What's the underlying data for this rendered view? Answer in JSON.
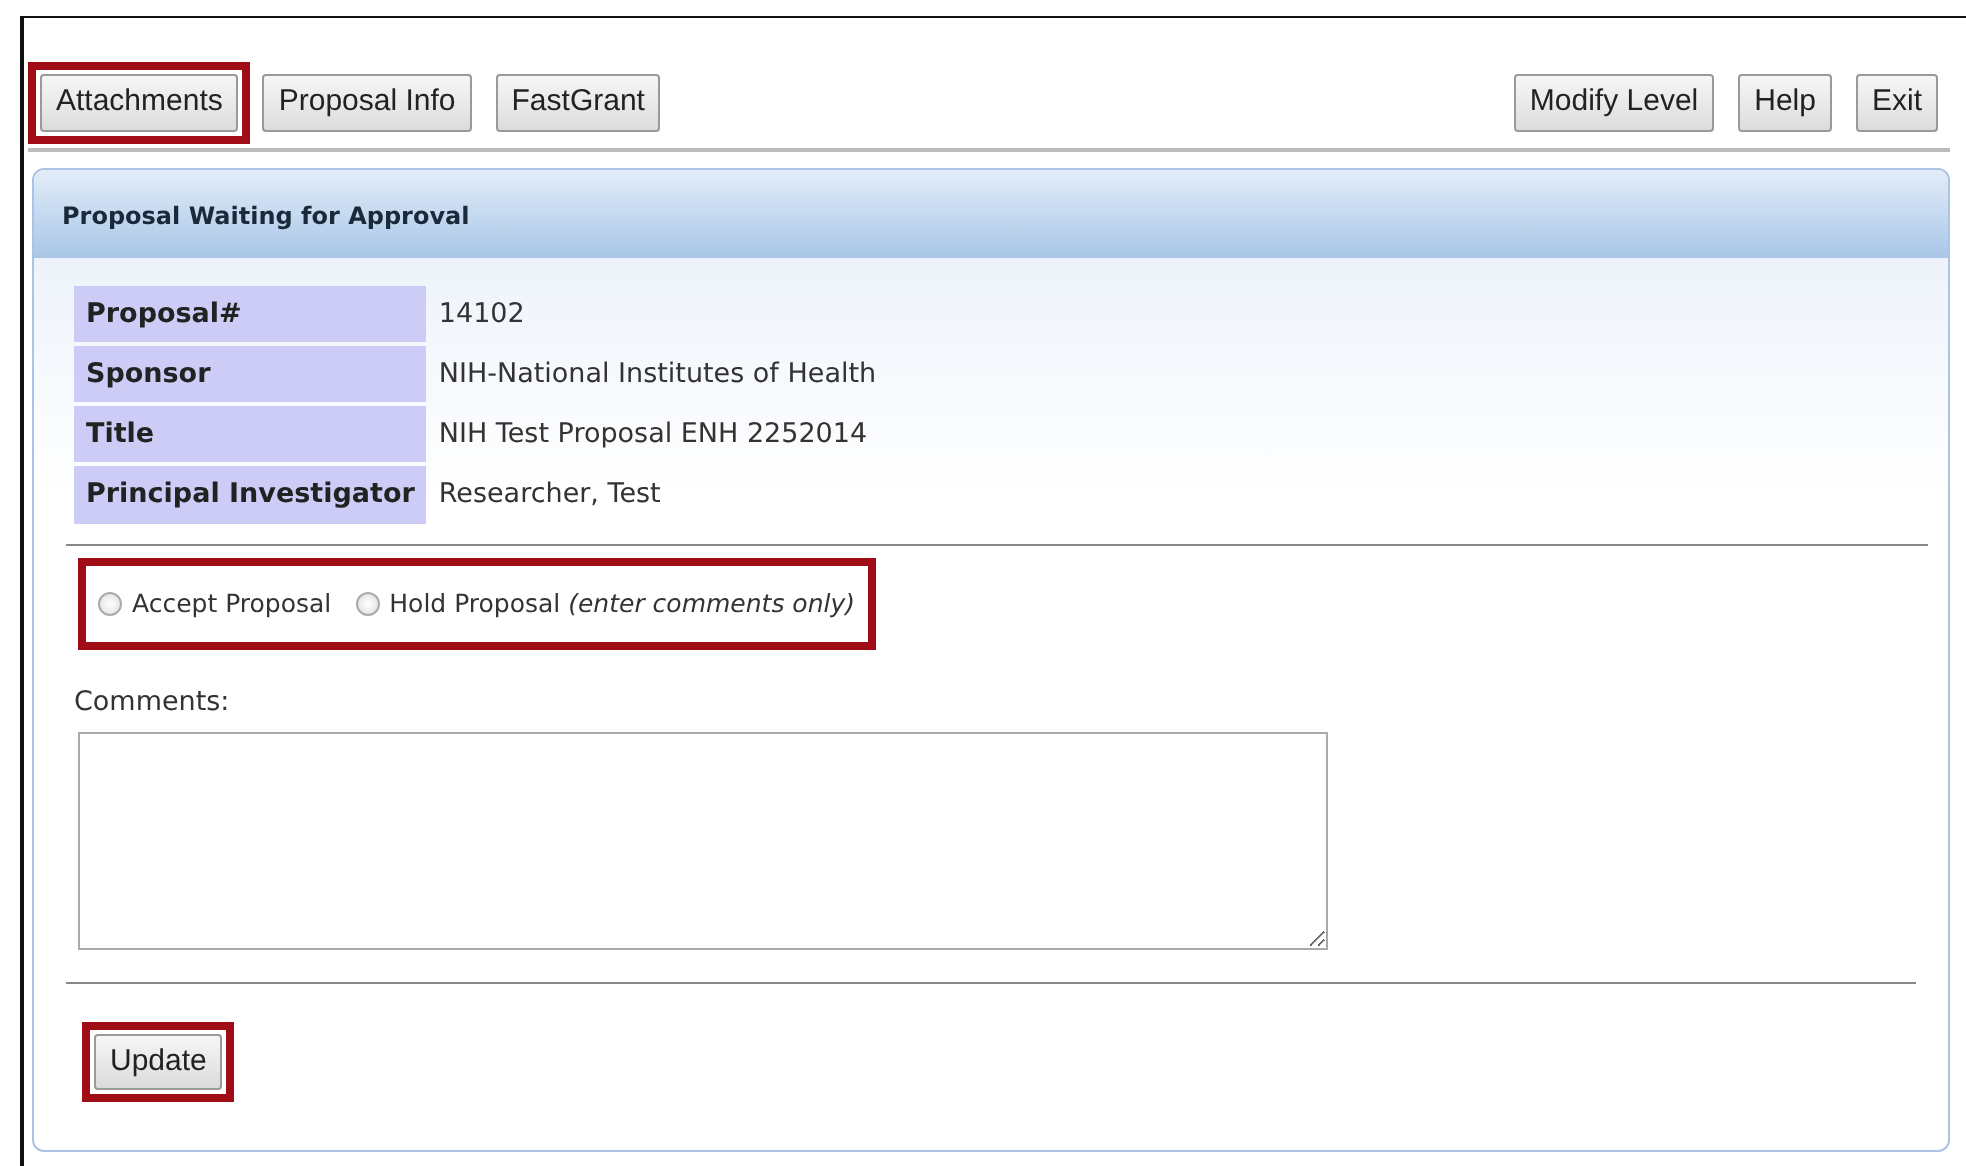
{
  "toolbar_left": [
    {
      "label": "Attachments",
      "highlighted": true
    },
    {
      "label": "Proposal Info",
      "highlighted": false
    },
    {
      "label": "FastGrant",
      "highlighted": false
    }
  ],
  "toolbar_right": [
    {
      "label": "Modify Level",
      "highlighted": false
    },
    {
      "label": "Help",
      "highlighted": false
    },
    {
      "label": "Exit",
      "highlighted": false
    }
  ],
  "panel": {
    "title": "Proposal Waiting for Approval"
  },
  "details": [
    {
      "label": "Proposal#",
      "value": "14102"
    },
    {
      "label": "Sponsor",
      "value": "NIH-National Institutes of Health"
    },
    {
      "label": "Title",
      "value": "NIH Test Proposal ENH 2252014"
    },
    {
      "label": "Principal Investigator",
      "value": "Researcher, Test"
    }
  ],
  "decision": {
    "highlighted": true,
    "options": [
      {
        "label": "Accept Proposal",
        "selected": false
      },
      {
        "label": "Hold Proposal *(enter comments only)*",
        "selected": false
      }
    ]
  },
  "comments": {
    "label": "Comments:"
  },
  "update_button": {
    "label": "Update",
    "highlighted": true
  }
}
